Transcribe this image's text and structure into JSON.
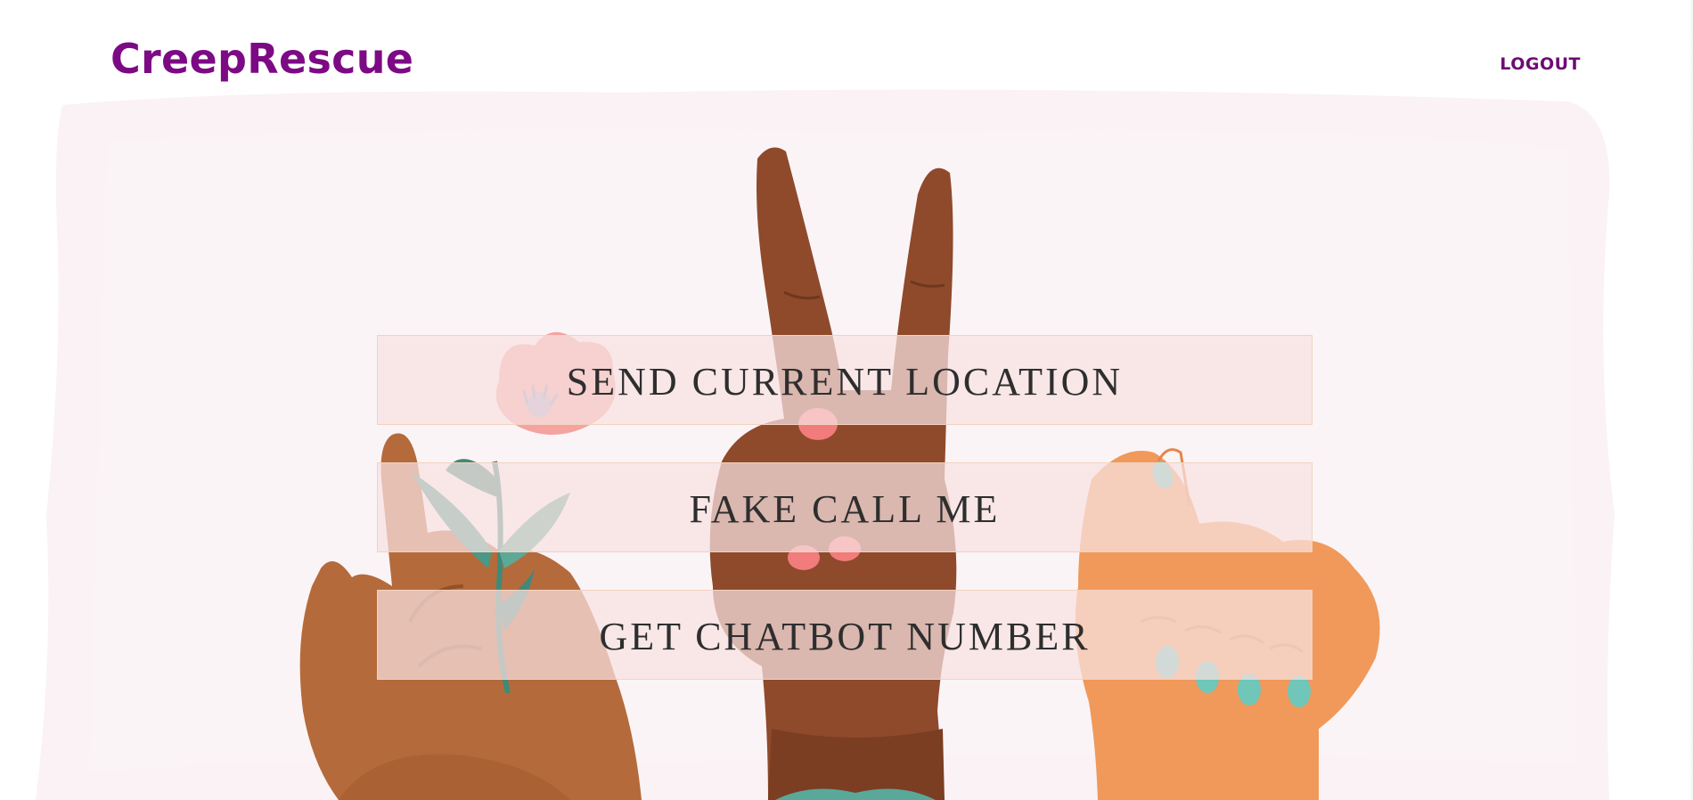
{
  "header": {
    "brand": "CreepRescue",
    "logout_label": "LOGOUT"
  },
  "actions": [
    {
      "label": "SEND CURRENT LOCATION"
    },
    {
      "label": "FAKE CALL ME"
    },
    {
      "label": "GET CHATBOT NUMBER"
    }
  ],
  "colors": {
    "brand": "#7d0a85",
    "background_wash": "#faf2f5",
    "button_fill": "#f8e2e2",
    "button_border": "#f3d2bf",
    "button_text": "#2e2e2e"
  },
  "hero": {
    "illustration": "three-raised-hands-peace-sign-flower-fist"
  }
}
